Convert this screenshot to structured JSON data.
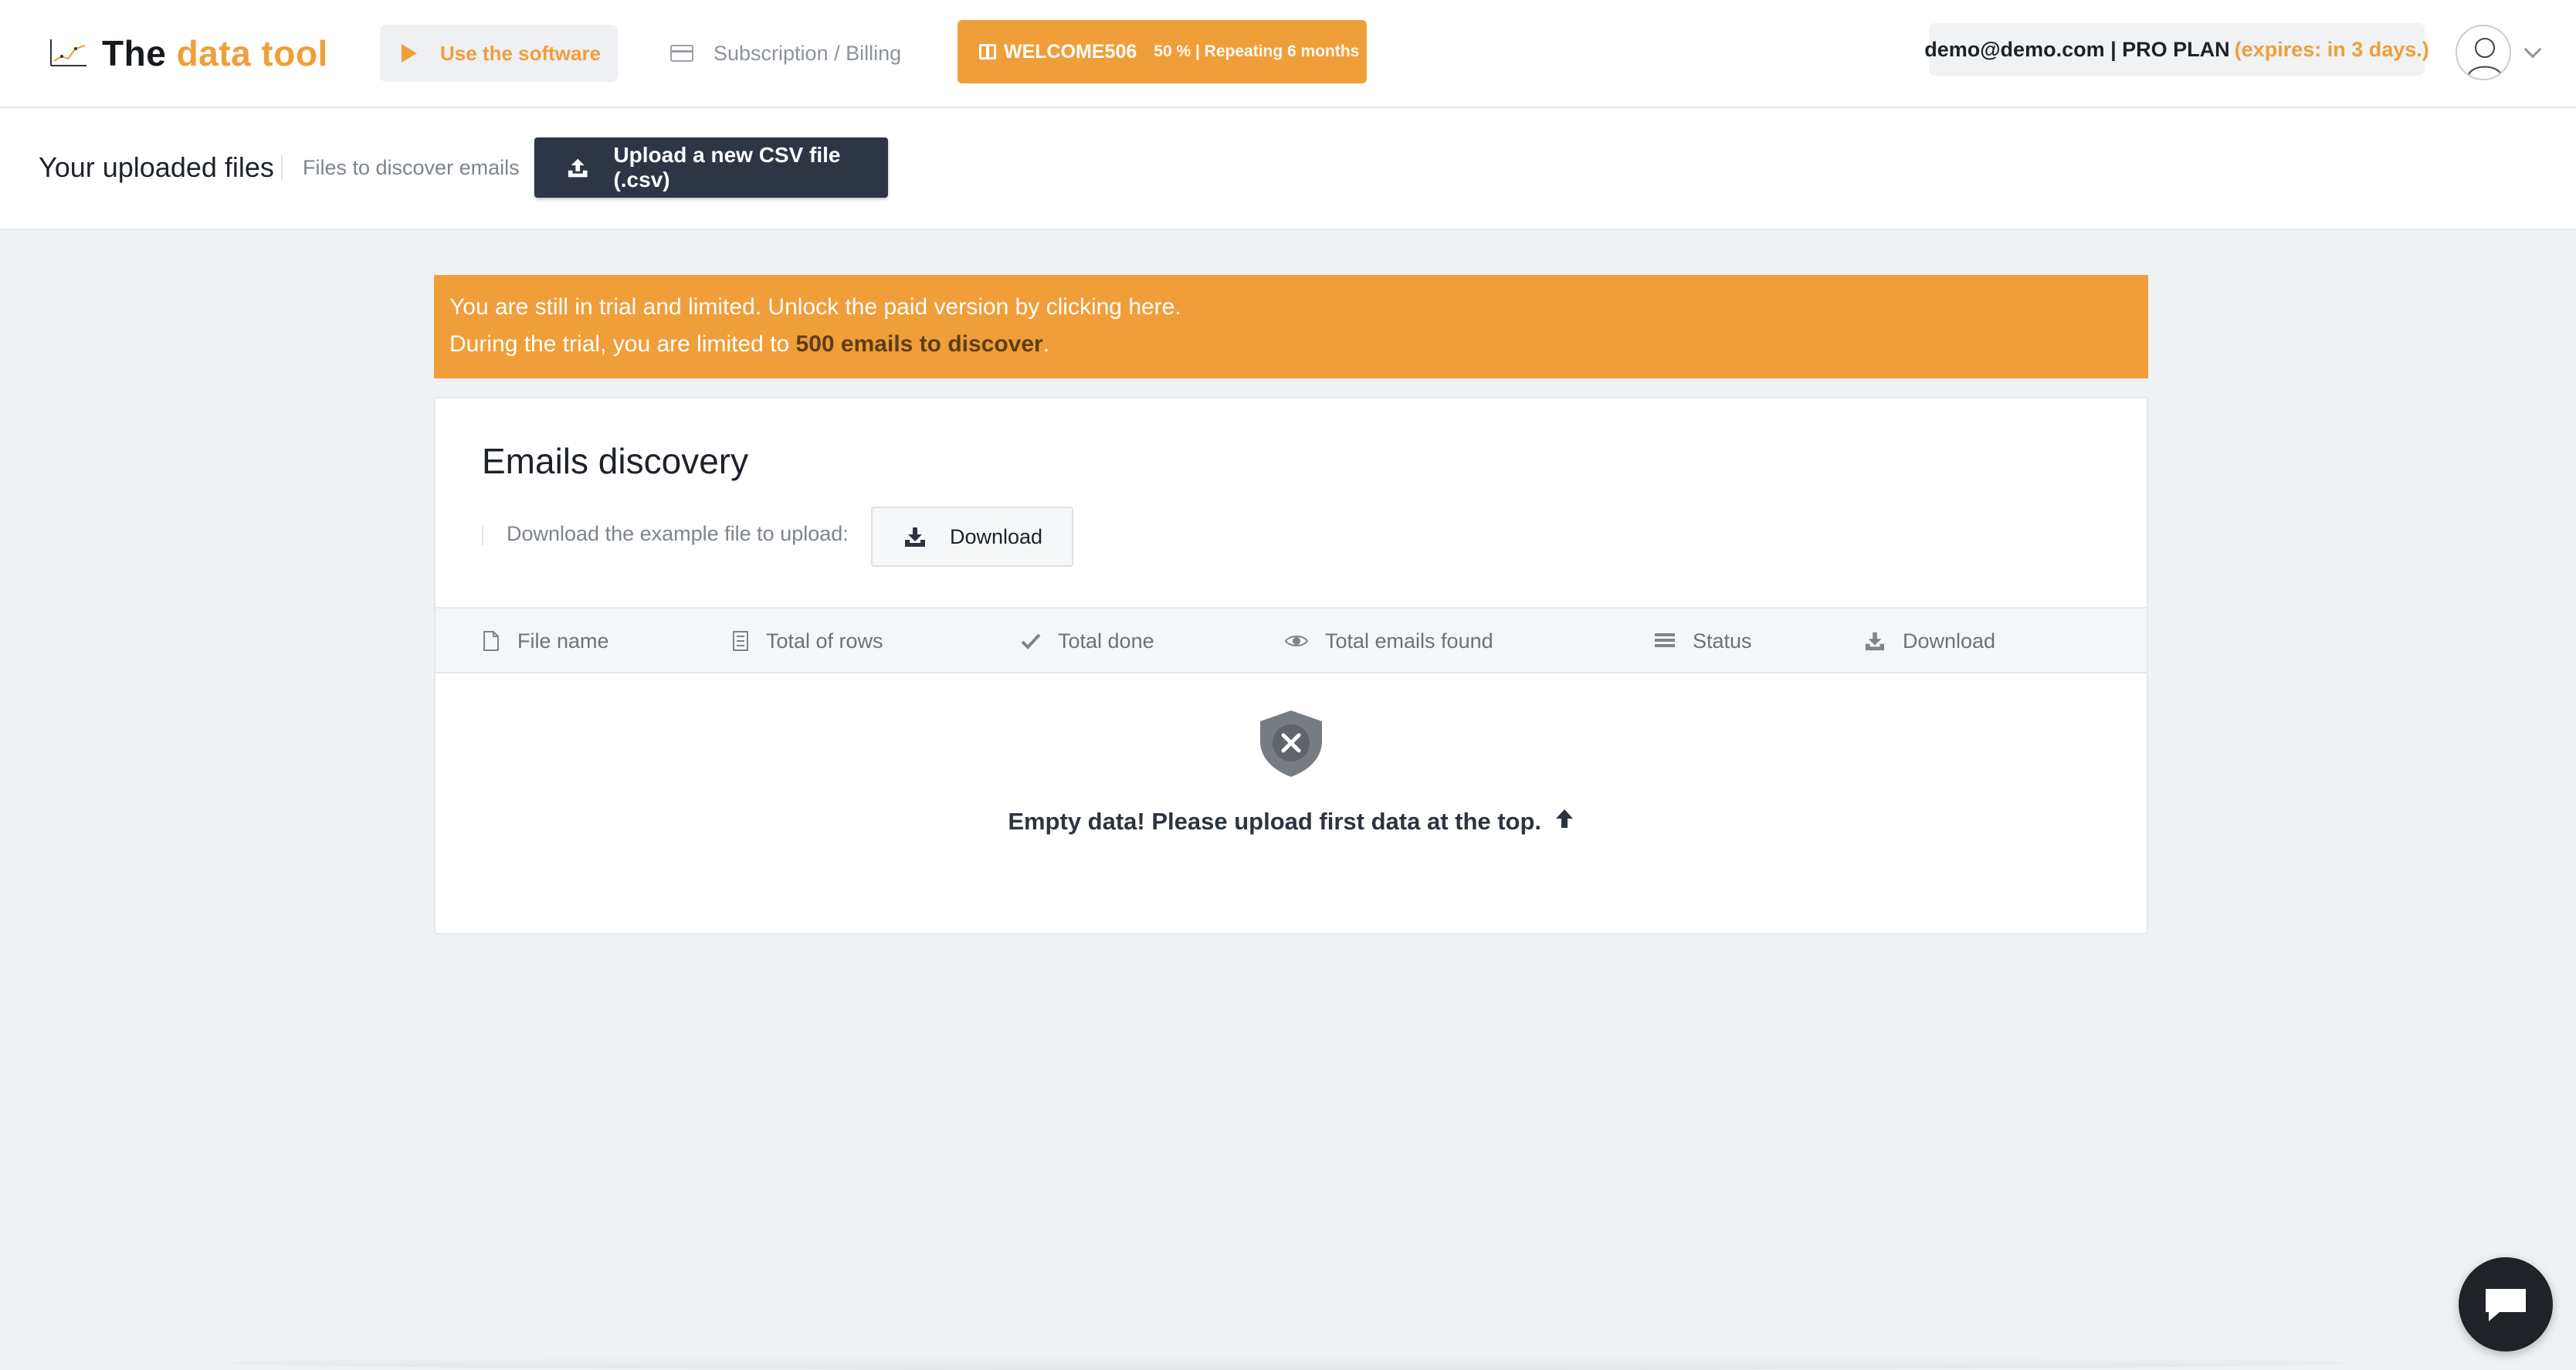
{
  "header": {
    "logo": {
      "word1": "The",
      "word2": "data tool",
      "icon": "chart-icon"
    },
    "nav": {
      "use_software": "Use the software",
      "billing": "Subscription / Billing"
    },
    "promo": {
      "code": "WELCOME506",
      "detail": "50 % | Repeating 6 months",
      "icon": "gift-icon"
    },
    "account": {
      "email": "demo@demo.com",
      "separator": " | ",
      "plan": "PRO PLAN",
      "expires": "(expires: in 3 days.)"
    }
  },
  "subheader": {
    "title": "Your uploaded files",
    "description": "Files to discover emails",
    "upload_button": "Upload a new CSV file (.csv)"
  },
  "alert": {
    "line1": "You are still in trial and limited. Unlock the paid version by clicking here.",
    "line2_prefix": "During the trial, you are limited to ",
    "line2_highlight": "500 emails to discover",
    "line2_suffix": "."
  },
  "panel": {
    "title": "Emails discovery",
    "example_label": "Download the example file to upload:",
    "example_button": "Download",
    "columns": [
      {
        "label": "File name",
        "icon": "file-icon"
      },
      {
        "label": "Total of rows",
        "icon": "rows-icon"
      },
      {
        "label": "Total done",
        "icon": "check-icon"
      },
      {
        "label": "Total emails found",
        "icon": "eye-icon"
      },
      {
        "label": "Status",
        "icon": "list-icon"
      },
      {
        "label": "Download",
        "icon": "download-icon"
      }
    ],
    "empty_message": "Empty data! Please upload first data at the top."
  },
  "colors": {
    "accent": "#f09e3a",
    "dark_button": "#2e3544",
    "background": "#eff2f5"
  }
}
